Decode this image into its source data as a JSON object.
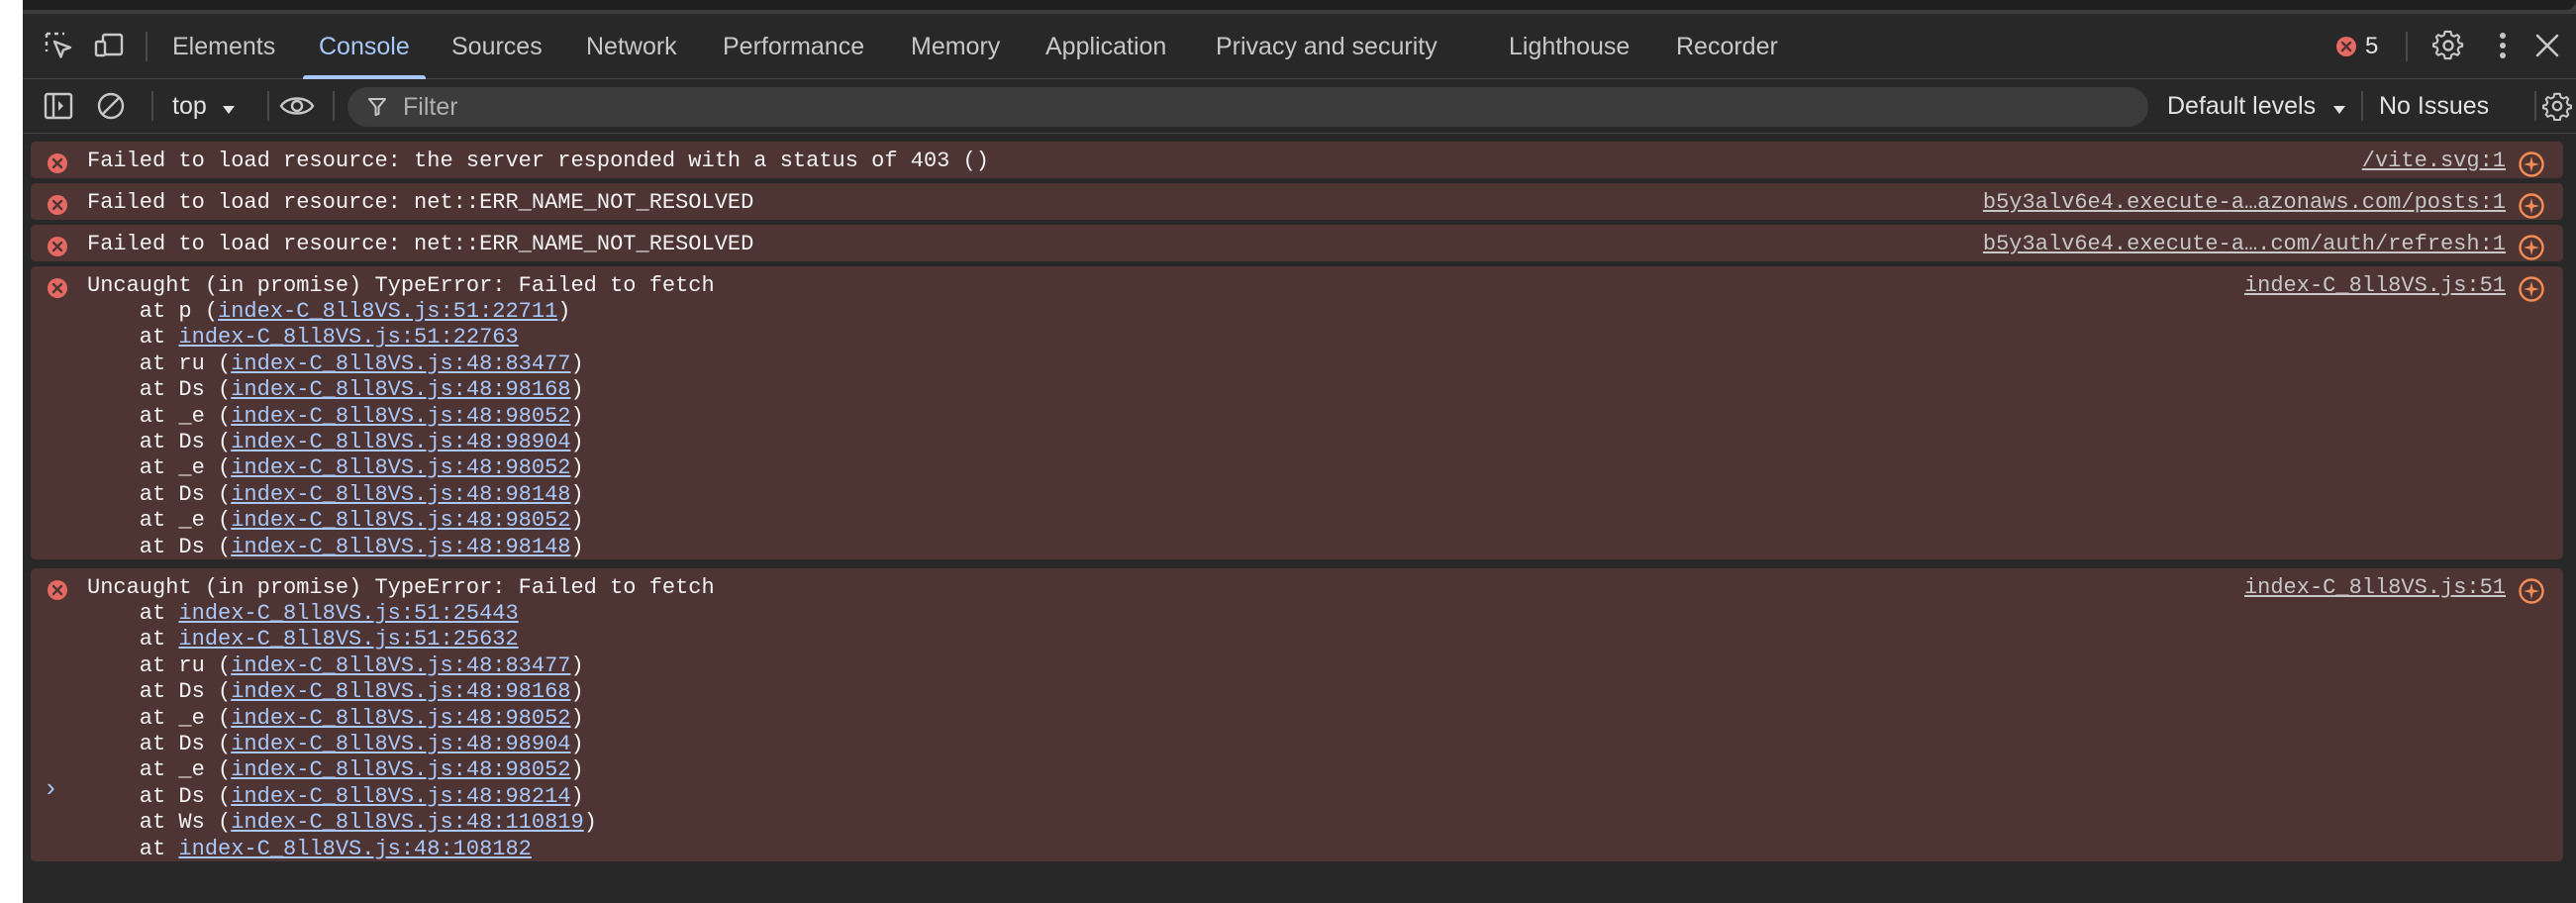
{
  "devtools": {
    "tabs": [
      {
        "label": "Elements"
      },
      {
        "label": "Console"
      },
      {
        "label": "Sources"
      },
      {
        "label": "Network"
      },
      {
        "label": "Performance"
      },
      {
        "label": "Memory"
      },
      {
        "label": "Application"
      },
      {
        "label": "Privacy and security"
      },
      {
        "label": "Lighthouse"
      },
      {
        "label": "Recorder"
      }
    ],
    "active_tab": "Console",
    "error_count": "5",
    "icons": {
      "inspect": "inspect-element-icon",
      "device": "device-toolbar-icon",
      "settings": "gear-icon",
      "more": "more-vertical-icon",
      "close": "close-icon"
    }
  },
  "console_toolbar": {
    "context": "top",
    "filter_placeholder": "Filter",
    "levels": "Default levels",
    "issues": "No Issues"
  },
  "messages": [
    {
      "text": "Failed to load resource: the server responded with a status of 403 ()",
      "source": "/vite.svg:1",
      "stack": []
    },
    {
      "text": "Failed to load resource: net::ERR_NAME_NOT_RESOLVED",
      "source": "b5y3alv6e4.execute-a…azonaws.com/posts:1",
      "stack": []
    },
    {
      "text": "Failed to load resource: net::ERR_NAME_NOT_RESOLVED",
      "source": "b5y3alv6e4.execute-a….com/auth/refresh:1",
      "stack": []
    },
    {
      "text": "Uncaught (in promise) TypeError: Failed to fetch",
      "source": "index-C_8ll8VS.js:51",
      "stack": [
        {
          "prefix": "    at p (",
          "link": "index-C_8ll8VS.js:51:22711",
          "suffix": ")"
        },
        {
          "prefix": "    at ",
          "link": "index-C_8ll8VS.js:51:22763",
          "suffix": ""
        },
        {
          "prefix": "    at ru (",
          "link": "index-C_8ll8VS.js:48:83477",
          "suffix": ")"
        },
        {
          "prefix": "    at Ds (",
          "link": "index-C_8ll8VS.js:48:98168",
          "suffix": ")"
        },
        {
          "prefix": "    at _e (",
          "link": "index-C_8ll8VS.js:48:98052",
          "suffix": ")"
        },
        {
          "prefix": "    at Ds (",
          "link": "index-C_8ll8VS.js:48:98904",
          "suffix": ")"
        },
        {
          "prefix": "    at _e (",
          "link": "index-C_8ll8VS.js:48:98052",
          "suffix": ")"
        },
        {
          "prefix": "    at Ds (",
          "link": "index-C_8ll8VS.js:48:98148",
          "suffix": ")"
        },
        {
          "prefix": "    at _e (",
          "link": "index-C_8ll8VS.js:48:98052",
          "suffix": ")"
        },
        {
          "prefix": "    at Ds (",
          "link": "index-C_8ll8VS.js:48:98148",
          "suffix": ")"
        }
      ]
    },
    {
      "text": "Uncaught (in promise) TypeError: Failed to fetch",
      "source": "index-C_8ll8VS.js:51",
      "stack": [
        {
          "prefix": "    at ",
          "link": "index-C_8ll8VS.js:51:25443",
          "suffix": ""
        },
        {
          "prefix": "    at ",
          "link": "index-C_8ll8VS.js:51:25632",
          "suffix": ""
        },
        {
          "prefix": "    at ru (",
          "link": "index-C_8ll8VS.js:48:83477",
          "suffix": ")"
        },
        {
          "prefix": "    at Ds (",
          "link": "index-C_8ll8VS.js:48:98168",
          "suffix": ")"
        },
        {
          "prefix": "    at _e (",
          "link": "index-C_8ll8VS.js:48:98052",
          "suffix": ")"
        },
        {
          "prefix": "    at Ds (",
          "link": "index-C_8ll8VS.js:48:98904",
          "suffix": ")"
        },
        {
          "prefix": "    at _e (",
          "link": "index-C_8ll8VS.js:48:98052",
          "suffix": ")"
        },
        {
          "prefix": "    at Ds (",
          "link": "index-C_8ll8VS.js:48:98214",
          "suffix": ")"
        },
        {
          "prefix": "    at Ws (",
          "link": "index-C_8ll8VS.js:48:110819",
          "suffix": ")"
        },
        {
          "prefix": "    at ",
          "link": "index-C_8ll8VS.js:48:108182",
          "suffix": ""
        }
      ]
    }
  ],
  "prompt_symbol": "›",
  "colors": {
    "background": "#282828",
    "error_row": "#4e3534",
    "accent": "#a8c7fa",
    "error_icon": "#e46962",
    "ai_icon": "#f28b54"
  }
}
